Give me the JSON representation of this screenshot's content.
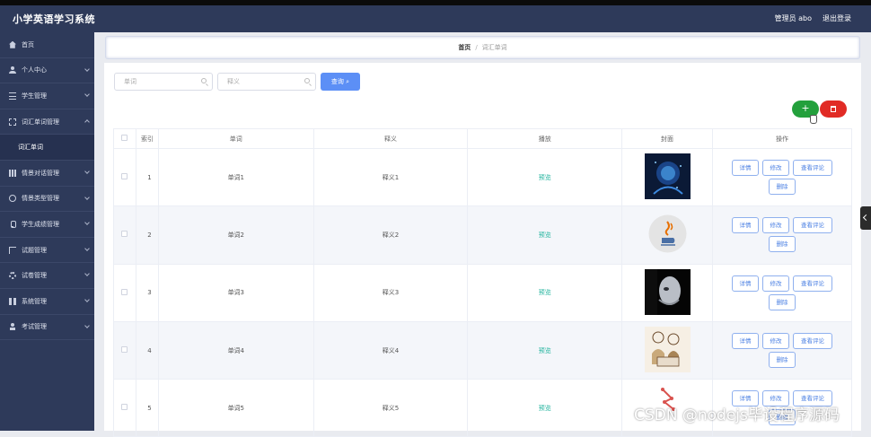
{
  "header": {
    "app_title": "小学英语学习系统",
    "admin_label": "管理员 abo",
    "logout_label": "退出登录"
  },
  "sidebar": {
    "items": [
      {
        "label": "首页",
        "icon": "home-icon"
      },
      {
        "label": "个人中心",
        "icon": "user-icon"
      },
      {
        "label": "学生管理",
        "icon": "list-icon"
      },
      {
        "label": "词汇单词管理",
        "icon": "frame-icon"
      },
      {
        "label": "词汇单词",
        "icon": ""
      },
      {
        "label": "情景对话管理",
        "icon": "grid-icon"
      },
      {
        "label": "情景类型管理",
        "icon": "circle-icon"
      },
      {
        "label": "学生成绩管理",
        "icon": "mic-icon"
      },
      {
        "label": "试题管理",
        "icon": "bracket-icon"
      },
      {
        "label": "试卷管理",
        "icon": "gear-icon"
      },
      {
        "label": "系统管理",
        "icon": "squares-icon"
      },
      {
        "label": "考试管理",
        "icon": "person-icon"
      }
    ]
  },
  "breadcrumb": {
    "home": "首页",
    "separator": "/",
    "current": "词汇单词"
  },
  "search": {
    "word_placeholder": "单词",
    "meaning_placeholder": "释义",
    "query_label": "查询"
  },
  "actions": {
    "add_label": "+",
    "delete_icon": "trash-icon"
  },
  "table": {
    "headers": [
      "",
      "索引",
      "单词",
      "释义",
      "播放",
      "封面",
      "操作"
    ],
    "rows": [
      {
        "index": "1",
        "word": "单词1",
        "meaning": "释义1",
        "play": "预览",
        "cover": "ai-face-image"
      },
      {
        "index": "2",
        "word": "单词2",
        "meaning": "释义2",
        "play": "预览",
        "cover": "java-logo-image"
      },
      {
        "index": "3",
        "word": "单词3",
        "meaning": "释义3",
        "play": "预览",
        "cover": "robot-face-image"
      },
      {
        "index": "4",
        "word": "单词4",
        "meaning": "释义4",
        "play": "预览",
        "cover": "people-laptop-sketch"
      },
      {
        "index": "5",
        "word": "单词5",
        "meaning": "释义5",
        "play": "预览",
        "cover": "network-logo-image"
      }
    ],
    "row_buttons": {
      "detail": "详情",
      "edit": "修改",
      "comments": "查看评论",
      "delete": "删除"
    }
  },
  "watermark": "CSDN @nodejs毕设程序源码",
  "colors": {
    "sidebar_bg": "#2e3a5a",
    "primary": "#5c8ff6",
    "add": "#23a03c",
    "delete": "#e12b25",
    "play_text": "#20b39d"
  }
}
